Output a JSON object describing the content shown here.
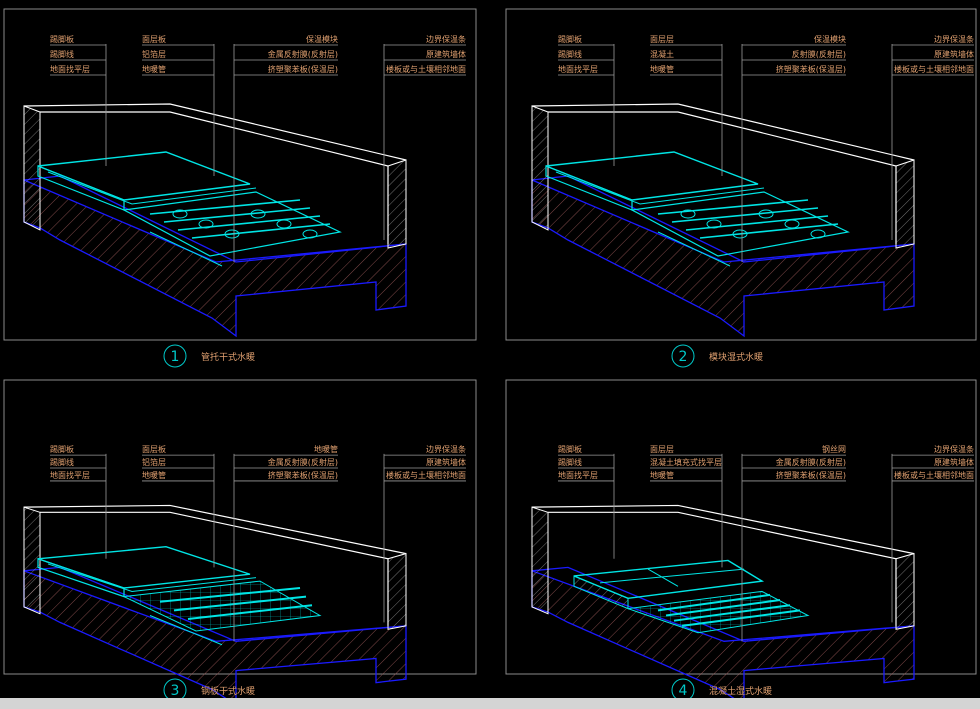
{
  "colors": {
    "background": "#000000",
    "frame": "#8a8a8a",
    "wall": "#ffffff",
    "slab": "#1a1aff",
    "hatch": "#a05a5a",
    "pipe": "#00e5e5",
    "leader": "#9a9a9a",
    "label": "#e0a070",
    "caption": "#e0a070",
    "badge": "#00c8c8"
  },
  "icons": [
    "detail-number-badge-icon"
  ],
  "panels": [
    {
      "number": "1",
      "title": "管托干式水暖",
      "labels": {
        "c1": [
          "踢脚板",
          "踢脚线",
          "地面找平层"
        ],
        "c2": [
          "面层板",
          "铝箔层",
          "地暖管"
        ],
        "c3": [
          "保温模块",
          "金属反射膜(反射层)",
          "挤塑聚苯板(保温层)"
        ],
        "c4": [
          "边界保温条",
          "原建筑墙体",
          "楼板或与土壤相邻地面"
        ]
      }
    },
    {
      "number": "2",
      "title": "模块湿式水暖",
      "labels": {
        "c1": [
          "踢脚板",
          "踢脚线",
          "地面找平层"
        ],
        "c2": [
          "面层层",
          "混凝土",
          "地暖管"
        ],
        "c3": [
          "保温模块",
          "反射膜(反射层)",
          "挤塑聚苯板(保温层)"
        ],
        "c4": [
          "边界保温条",
          "原建筑墙体",
          "楼板或与土壤相邻地面"
        ]
      }
    },
    {
      "number": "3",
      "title": "钢板干式水暖",
      "labels": {
        "c1": [
          "踢脚板",
          "踢脚线",
          "地面找平层"
        ],
        "c2": [
          "面层板",
          "铝箔层",
          "地暖管"
        ],
        "c3": [
          "地暖管",
          "金属反射膜(反射层)",
          "挤塑聚苯板(保温层)"
        ],
        "c4": [
          "边界保温条",
          "原建筑墙体",
          "楼板或与土壤相邻地面"
        ]
      }
    },
    {
      "number": "4",
      "title": "混凝土湿式水暖",
      "labels": {
        "c1": [
          "踢脚板",
          "踢脚线",
          "地面找平层"
        ],
        "c2": [
          "面层层",
          "混凝土填充式找平层",
          "地暖管"
        ],
        "c3": [
          "钢丝网",
          "金属反射膜(反射层)",
          "挤塑聚苯板(保温层)"
        ],
        "c4": [
          "边界保温条",
          "原建筑墙体",
          "楼板或与土壤相邻地面"
        ]
      }
    }
  ]
}
